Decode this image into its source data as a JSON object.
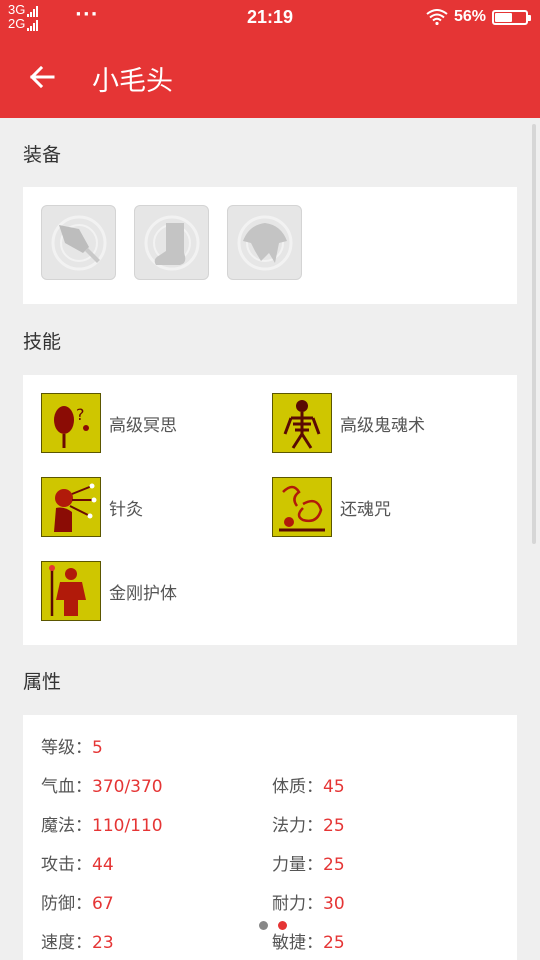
{
  "status_bar": {
    "net1": "3G",
    "net2": "2G",
    "more": "···",
    "time": "21:19",
    "battery": "56%",
    "battery_level": 0.56
  },
  "app_bar": {
    "title": "小毛头"
  },
  "sections": {
    "equipment": "装备",
    "skills": "技能",
    "attributes": "属性"
  },
  "equipment": [
    {
      "icon": "sword-icon"
    },
    {
      "icon": "boot-icon"
    },
    {
      "icon": "armor-icon"
    }
  ],
  "skills": [
    {
      "name": "高级冥思",
      "icon": "meditation-skill-icon"
    },
    {
      "name": "高级鬼魂术",
      "icon": "skeleton-skill-icon"
    },
    {
      "name": "针灸",
      "icon": "acupuncture-skill-icon"
    },
    {
      "name": "还魂咒",
      "icon": "revive-skill-icon"
    },
    {
      "name": "金刚护体",
      "icon": "vajra-guard-skill-icon"
    }
  ],
  "attributes": [
    {
      "label": "等级：",
      "value": "5"
    },
    {
      "label": "气血：",
      "value": "370/370"
    },
    {
      "label": "体质：",
      "value": "45"
    },
    {
      "label": "魔法：",
      "value": "110/110"
    },
    {
      "label": "法力：",
      "value": "25"
    },
    {
      "label": "攻击：",
      "value": "44"
    },
    {
      "label": "力量：",
      "value": "25"
    },
    {
      "label": "防御：",
      "value": "67"
    },
    {
      "label": "耐力：",
      "value": "30"
    },
    {
      "label": "速度：",
      "value": "23"
    },
    {
      "label": "敏捷：",
      "value": "25"
    }
  ],
  "colors": {
    "primary": "#e53535",
    "value": "#e53535",
    "skill_bg": "#c8c000"
  },
  "pager": {
    "count": 2,
    "active": 1
  }
}
